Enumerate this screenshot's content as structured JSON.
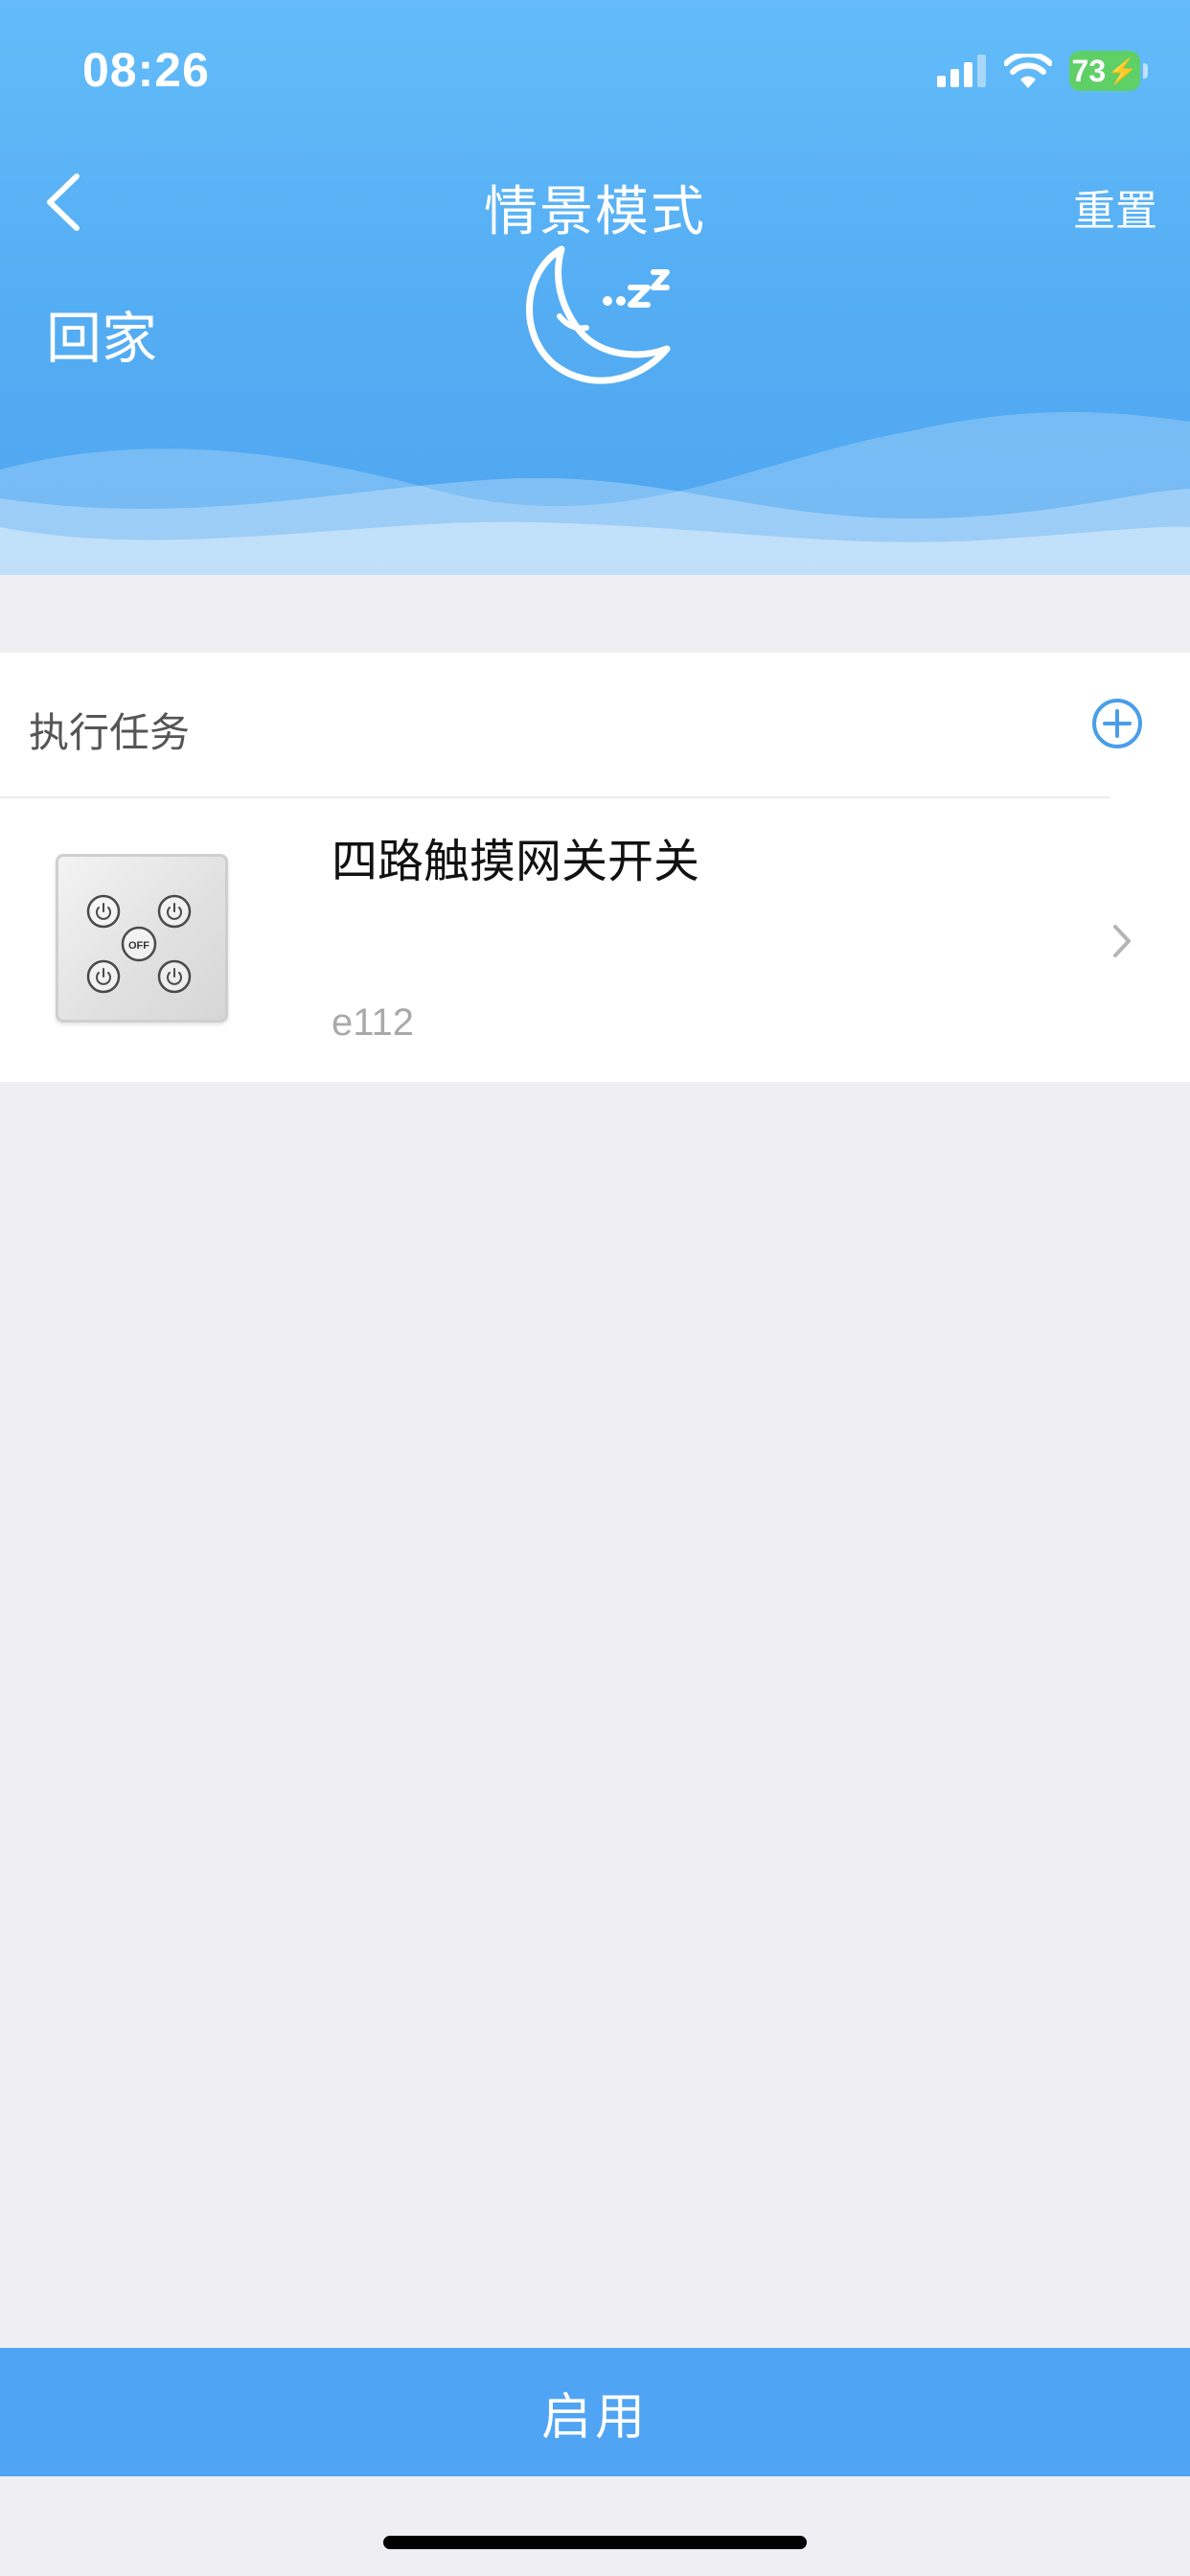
{
  "status_bar": {
    "time": "08:26",
    "battery_level": "73",
    "icons": [
      "signal-icon",
      "wifi-icon",
      "battery-charging-icon"
    ]
  },
  "header": {
    "title": "情景模式",
    "reset_label": "重置",
    "scene_name": "回家",
    "scene_icon": "moon-sleep-icon",
    "back_icon": "back-arrow-icon"
  },
  "tasks": {
    "section_title": "执行任务",
    "add_icon": "add-circle-icon",
    "items": [
      {
        "name": "四路触摸网关开关",
        "id": "e112",
        "image_icon": "touch-switch-panel-icon",
        "image_label": "OFF"
      }
    ]
  },
  "footer": {
    "enable_label": "启用"
  },
  "colors": {
    "header_top": "#63bcf9",
    "header_bottom": "#4fa6f0",
    "accent": "#50a4f4",
    "page_bg": "#eeeef3",
    "add_icon": "#4a9ee8"
  }
}
